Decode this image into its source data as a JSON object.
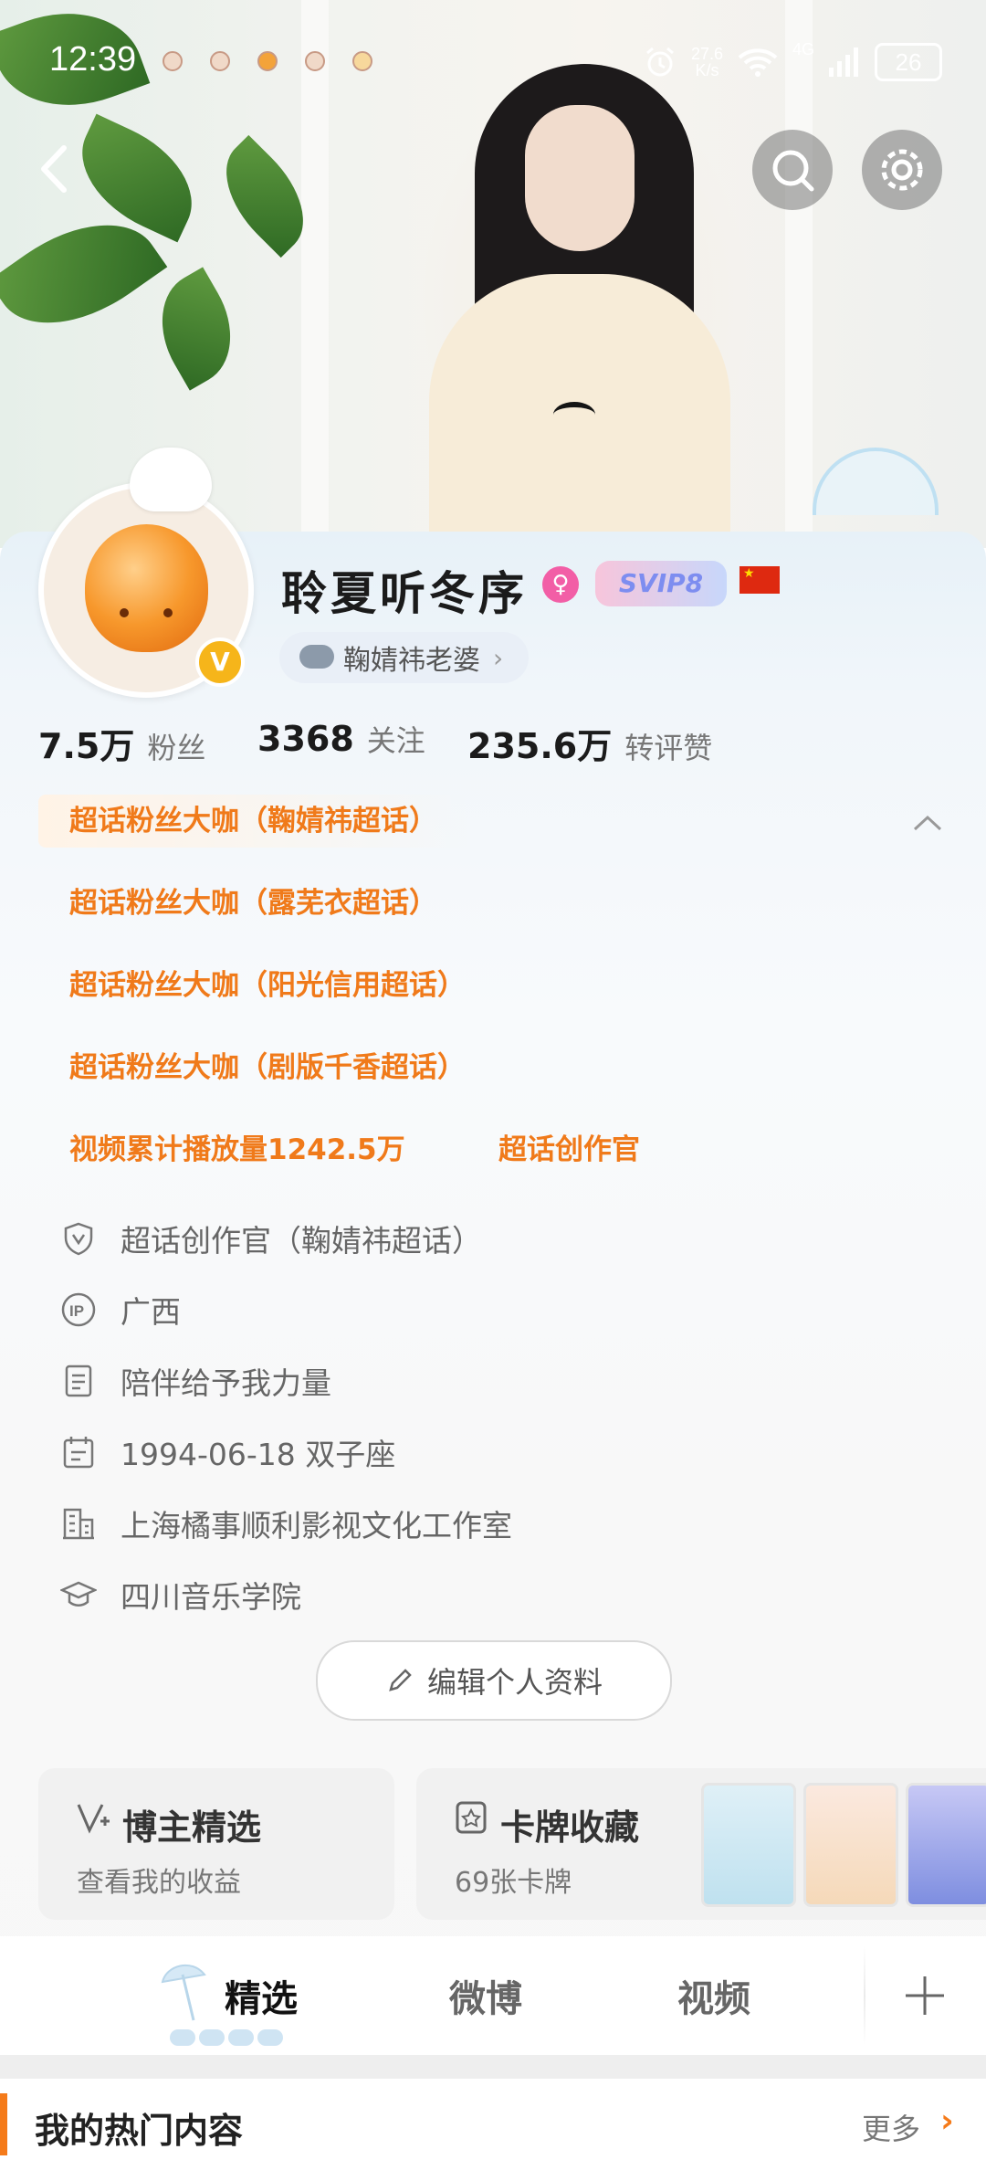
{
  "status_bar": {
    "time": "12:39",
    "net_speed_value": "27.6",
    "net_speed_unit": "K/s",
    "network": "4G",
    "battery": "26"
  },
  "header": {
    "back_icon": "chevron-left-icon",
    "search_icon": "search-icon",
    "settings_icon": "gear-icon"
  },
  "profile": {
    "name": "聆夏听冬序",
    "svip_label": "SVIP8",
    "subtitle": "鞠婧祎老婆",
    "stats": [
      {
        "value": "7.5万",
        "label": "粉丝"
      },
      {
        "value": "3368",
        "label": "关注"
      },
      {
        "value": "235.6万",
        "label": "转评赞"
      }
    ],
    "tags": [
      "超话粉丝大咖（鞠婧祎超话）",
      "超话粉丝大咖（露芜衣超话）",
      "超话粉丝大咖（阳光信用超话）",
      "超话粉丝大咖（剧版千香超话）"
    ],
    "video_plays": "视频累计播放量1242.5万",
    "creator_tag": "超话创作官",
    "info": [
      {
        "icon": "shield-v-icon",
        "text": "超话创作官（鞠婧祎超话）"
      },
      {
        "icon": "ip-icon",
        "text": "广西"
      },
      {
        "icon": "document-icon",
        "text": "陪伴给予我力量"
      },
      {
        "icon": "calendar-icon",
        "text": "1994-06-18 双子座"
      },
      {
        "icon": "building-icon",
        "text": "上海橘事顺利影视文化工作室"
      },
      {
        "icon": "graduation-cap-icon",
        "text": "四川音乐学院"
      }
    ],
    "edit_label": "编辑个人资料"
  },
  "cards": {
    "blogger": {
      "title": "博主精选",
      "subtitle": "查看我的收益"
    },
    "collection": {
      "title": "卡牌收藏",
      "subtitle": "69张卡牌"
    }
  },
  "tabs": [
    "精选",
    "微博",
    "视频"
  ],
  "hot": {
    "title": "我的热门内容",
    "more": "更多"
  },
  "colors": {
    "accent": "#f07a1a",
    "verified": "#f6b51a",
    "gender": "#f25ea6"
  }
}
